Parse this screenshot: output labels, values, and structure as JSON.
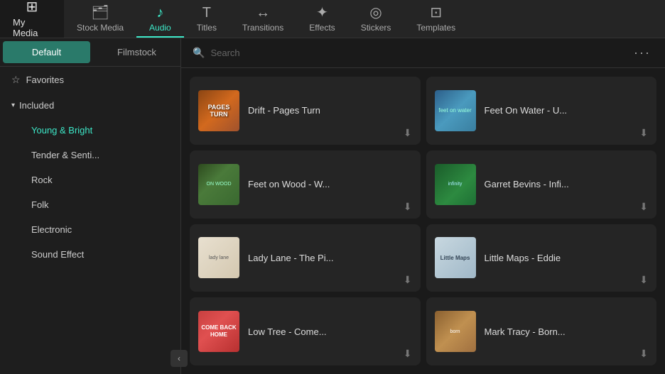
{
  "topNav": {
    "items": [
      {
        "id": "my-media",
        "label": "My Media",
        "icon": "⊞",
        "active": false,
        "isFirst": true
      },
      {
        "id": "stock-media",
        "label": "Stock Media",
        "icon": "🗂",
        "active": false
      },
      {
        "id": "audio",
        "label": "Audio",
        "icon": "♪",
        "active": true
      },
      {
        "id": "titles",
        "label": "Titles",
        "icon": "T",
        "active": false
      },
      {
        "id": "transitions",
        "label": "Transitions",
        "icon": "↔",
        "active": false
      },
      {
        "id": "effects",
        "label": "Effects",
        "icon": "✦",
        "active": false
      },
      {
        "id": "stickers",
        "label": "Stickers",
        "icon": "◎",
        "active": false
      },
      {
        "id": "templates",
        "label": "Templates",
        "icon": "⊡",
        "active": false
      }
    ]
  },
  "sidebar": {
    "tabs": [
      {
        "id": "default",
        "label": "Default",
        "active": true
      },
      {
        "id": "filmstock",
        "label": "Filmstock",
        "active": false
      }
    ],
    "favorites": {
      "label": "Favorites",
      "icon": "☆"
    },
    "included": {
      "label": "Included",
      "expanded": true,
      "subItems": [
        {
          "id": "young-bright",
          "label": "Young & Bright",
          "active": true
        },
        {
          "id": "tender-senti",
          "label": "Tender & Senti..."
        },
        {
          "id": "rock",
          "label": "Rock"
        },
        {
          "id": "folk",
          "label": "Folk"
        },
        {
          "id": "electronic",
          "label": "Electronic"
        },
        {
          "id": "sound-effect",
          "label": "Sound Effect"
        }
      ]
    }
  },
  "search": {
    "placeholder": "Search"
  },
  "moreButton": "···",
  "musicCards": [
    {
      "id": "drift",
      "title": "Drift - Pages Turn",
      "artClass": "art-drift",
      "artText": "PAGES TURN"
    },
    {
      "id": "feet-water",
      "title": "Feet On Water - U...",
      "artClass": "art-feet-water",
      "artText": ""
    },
    {
      "id": "feet-wood",
      "title": "Feet on Wood - W...",
      "artClass": "art-feet-wood",
      "artText": ""
    },
    {
      "id": "garret",
      "title": "Garret Bevins - Infi...",
      "artClass": "art-garret",
      "artText": ""
    },
    {
      "id": "lady-lane",
      "title": "Lady Lane - The Pi...",
      "artClass": "art-lady-lane",
      "artText": ""
    },
    {
      "id": "little-maps",
      "title": "Little Maps - Eddie",
      "artClass": "art-little-maps",
      "artText": "Little Maps"
    },
    {
      "id": "low-tree",
      "title": "Low Tree - Come...",
      "artClass": "art-low-tree",
      "artText": ""
    },
    {
      "id": "mark-tracy",
      "title": "Mark Tracy - Born...",
      "artClass": "art-mark-tracy",
      "artText": ""
    }
  ],
  "collapseIcon": "‹"
}
